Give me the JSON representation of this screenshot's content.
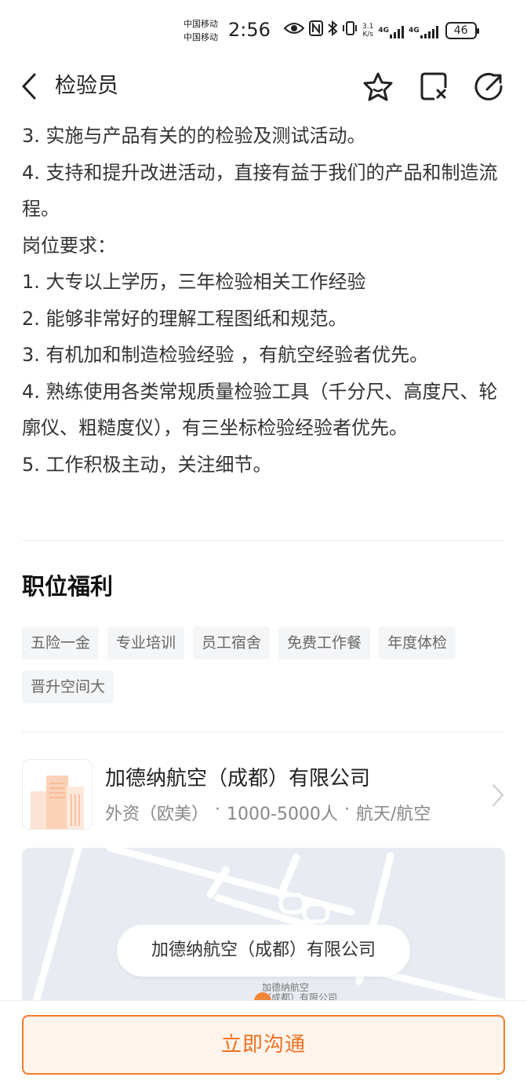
{
  "status_bar": {
    "carrier_1": "中国移动",
    "carrier_2": "中国移动",
    "time": "2:56",
    "net_speed_value": "3.1",
    "net_speed_unit": "K/s",
    "signal_1": "4G",
    "signal_2": "4G",
    "battery": "46"
  },
  "navbar": {
    "title": "检验员",
    "icons": [
      "back-arrow-icon",
      "favorite-star-icon",
      "report-icon",
      "share-icon"
    ]
  },
  "description": {
    "lines": [
      "3. 实施与产品有关的的检验及测试活动。",
      "4. 支持和提升改进活动，直接有益于我们的产品和制造流程。",
      "岗位要求：",
      "1. 大专以上学历，三年检验相关工作经验",
      "2. 能够非常好的理解工程图纸和规范。",
      "3. 有机加和制造检验经验 ，有航空经验者优先。",
      "4. 熟练使用各类常规质量检验工具（千分尺、高度尺、轮廓仪、粗糙度仪），有三坐标检验经验者优先。",
      "5. 工作积极主动，关注细节。"
    ]
  },
  "benefits": {
    "title": "职位福利",
    "tags": [
      "五险一金",
      "专业培训",
      "员工宿舍",
      "免费工作餐",
      "年度体检",
      "晋升空间大"
    ]
  },
  "company": {
    "name": "加德纳航空（成都）有限公司",
    "type": "外资（欧美）",
    "size": "1000-5000人",
    "industry": "航天/航空",
    "separator": "·"
  },
  "map": {
    "label": "加德纳航空（成都）有限公司",
    "small_label_1": "加德纳航空",
    "small_label_2": "（成都）有限公司"
  },
  "action": {
    "chat_label": "立即沟通"
  },
  "colors": {
    "accent": "#f47b2a",
    "tag_bg": "#f4f5f7",
    "map_bg": "#e8ecf2"
  }
}
